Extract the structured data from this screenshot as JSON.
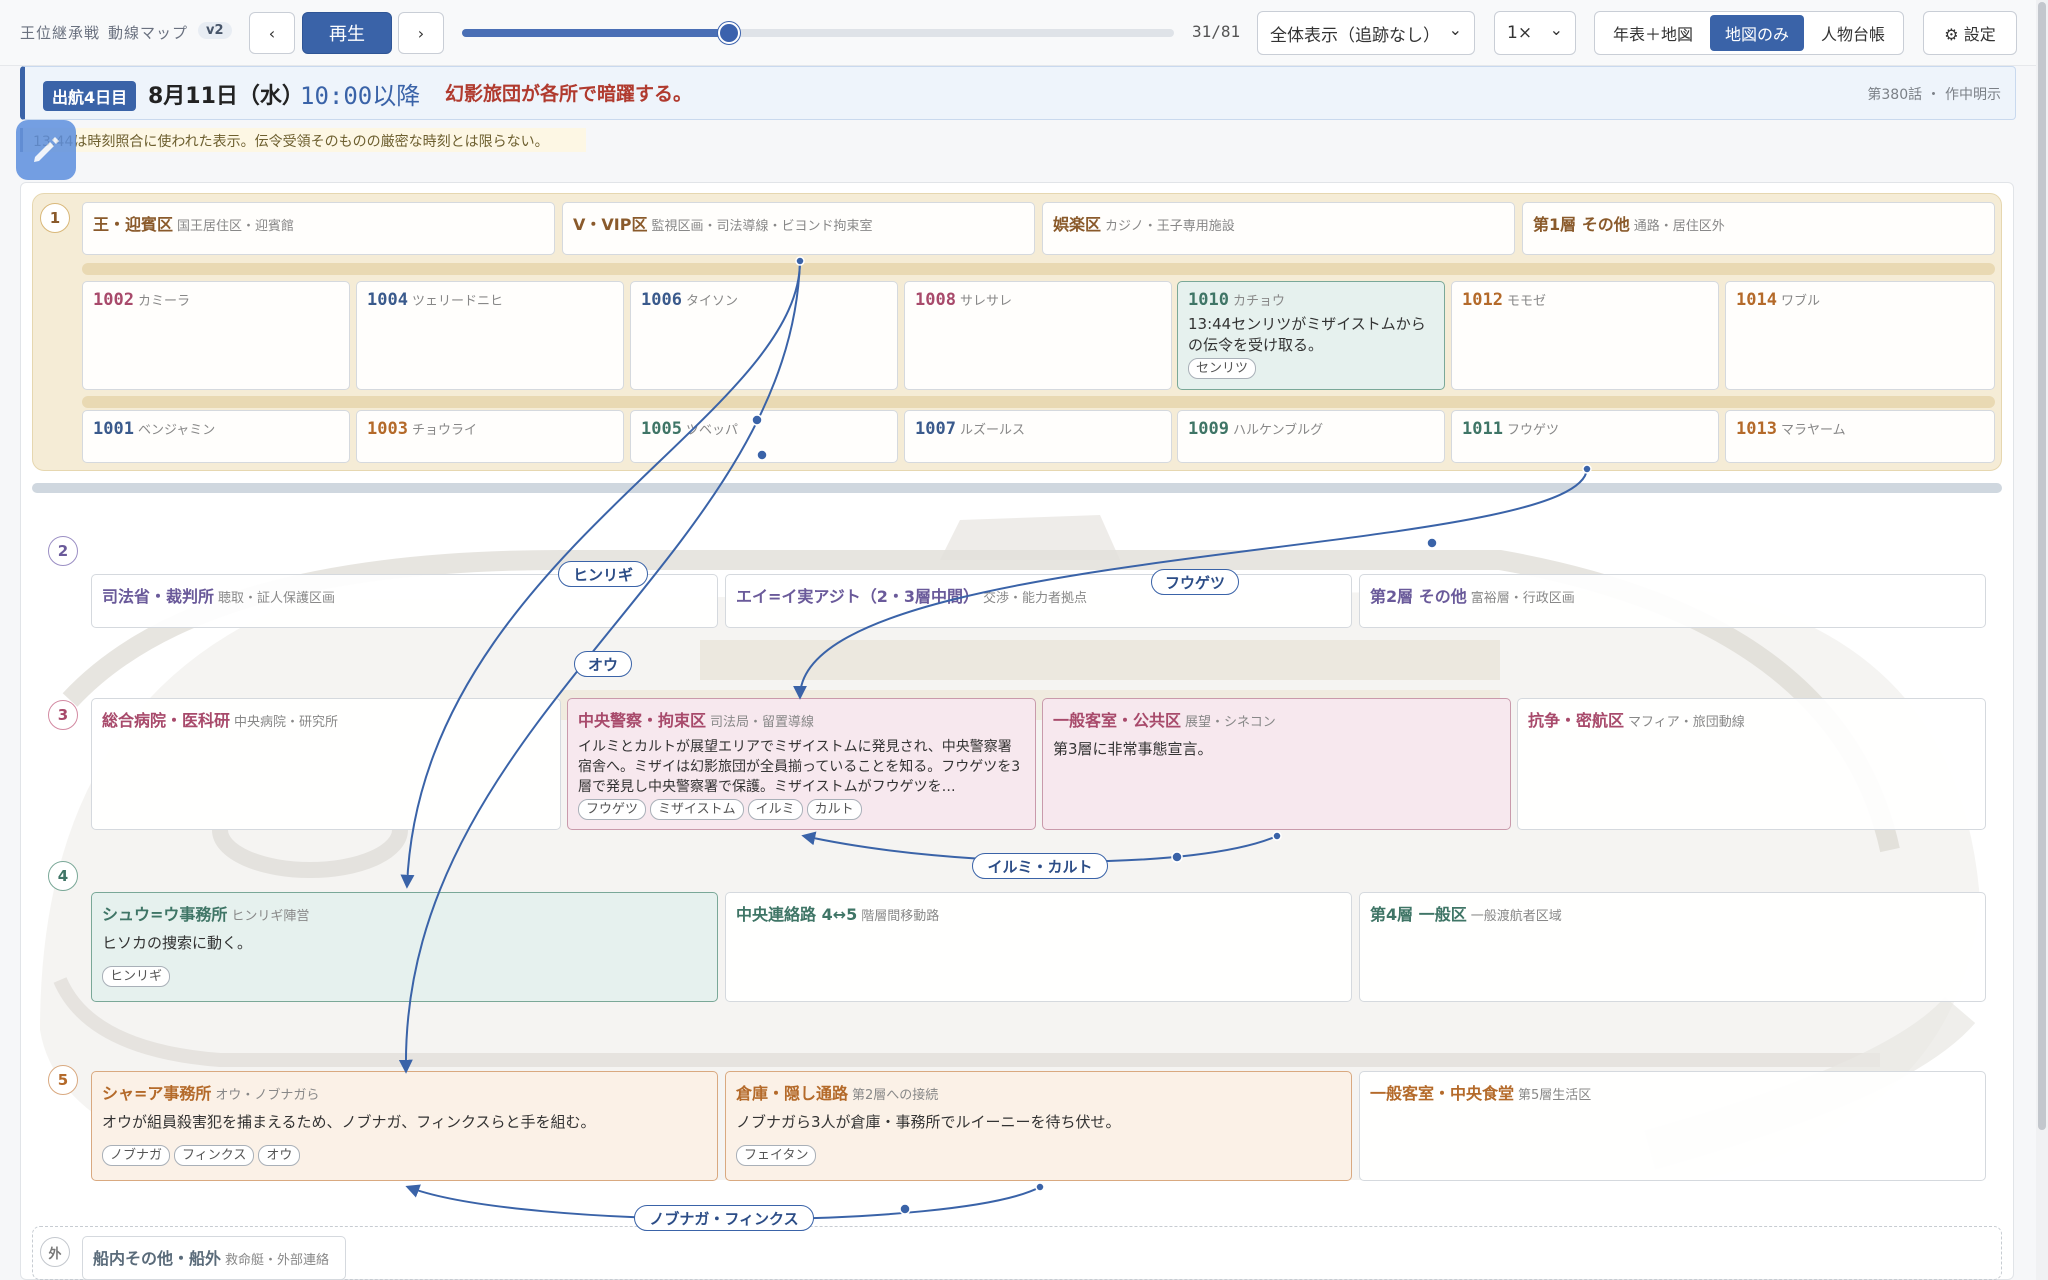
{
  "toolbar": {
    "app_title": "王位継承戦",
    "app_subtitle": "動線マップ",
    "version": "v2",
    "prev_label": "‹",
    "play_label": "再生",
    "next_label": "›",
    "counter": "31/81",
    "progress_fraction": 0.375,
    "view_select": "全体表示（追跡なし）",
    "speed_select": "1×",
    "modes": [
      "年表＋地図",
      "地図のみ",
      "人物台帳"
    ],
    "active_mode": "地図のみ",
    "settings_label": "⚙ 設定"
  },
  "banner": {
    "day": "出航4日目",
    "date": "8月11日（水）",
    "time": "10:00以降",
    "event": "幻影旅団が各所で暗躍する。",
    "episode": "第380話 ・ 作中明示"
  },
  "note": "13:44は時刻照合に使われた表示。伝令受領そのものの厳密な時刻とは限らない。",
  "floors": {
    "f1": {
      "badge": "1",
      "zones": [
        {
          "title": "王・迎賓区",
          "sub": "国王居住区・迎賓館"
        },
        {
          "title": "V・VIP区",
          "sub": "監視区画・司法導線・ビヨンド拘束室"
        },
        {
          "title": "娯楽区",
          "sub": "カジノ・王子専用施設"
        },
        {
          "title": "第1層 その他",
          "sub": "通路・居住区外"
        }
      ],
      "rooms_top": [
        {
          "num": "1002",
          "name": "カミーラ"
        },
        {
          "num": "1004",
          "name": "ツェリードニヒ"
        },
        {
          "num": "1006",
          "name": "タイソン"
        },
        {
          "num": "1008",
          "name": "サレサレ"
        },
        {
          "num": "1010",
          "name": "カチョウ",
          "text": "13:44センリツがミザイストムからの伝令を受け取る。",
          "chips": [
            "センリツ"
          ]
        },
        {
          "num": "1012",
          "name": "モモゼ"
        },
        {
          "num": "1014",
          "name": "ワブル"
        }
      ],
      "rooms_bottom": [
        {
          "num": "1001",
          "name": "ベンジャミン"
        },
        {
          "num": "1003",
          "name": "チョウライ"
        },
        {
          "num": "1005",
          "name": "ツベッパ"
        },
        {
          "num": "1007",
          "name": "ルズールス"
        },
        {
          "num": "1009",
          "name": "ハルケンブルグ"
        },
        {
          "num": "1011",
          "name": "フウゲツ"
        },
        {
          "num": "1013",
          "name": "マラヤーム"
        }
      ]
    },
    "f2": {
      "badge": "2",
      "zones": [
        {
          "title": "司法省・裁判所",
          "sub": "聴取・証人保護区画"
        },
        {
          "title": "エイ=イ実アジト（2・3層中間）",
          "sub": "交渉・能力者拠点"
        },
        {
          "title": "第2層 その他",
          "sub": "富裕層・行政区画"
        }
      ]
    },
    "f3": {
      "badge": "3",
      "zones": [
        {
          "title": "総合病院・医科研",
          "sub": "中央病院・研究所"
        },
        {
          "title": "中央警察・拘束区",
          "sub": "司法局・留置導線",
          "text": "イルミとカルトが展望エリアでミザイストムに発見され、中央警察署宿舎へ。ミザイは幻影旅団が全員揃っていることを知る。フウゲツを3層で発見し中央警察署で保護。ミザイストムがフウゲツを…",
          "chips": [
            "フウゲツ",
            "ミザイストム",
            "イルミ",
            "カルト"
          ]
        },
        {
          "title": "一般客室・公共区",
          "sub": "展望・シネコン",
          "text": "第3層に非常事態宣言。"
        },
        {
          "title": "抗争・密航区",
          "sub": "マフィア・旅団動線"
        }
      ]
    },
    "f4": {
      "badge": "4",
      "zones": [
        {
          "title": "シュウ=ウ事務所",
          "sub": "ヒンリギ陣営",
          "text": "ヒソカの捜索に動く。",
          "chips": [
            "ヒンリギ"
          ]
        },
        {
          "title": "中央連絡路 4↔5",
          "sub": "階層間移動路"
        },
        {
          "title": "第4層 一般区",
          "sub": "一般渡航者区域"
        }
      ]
    },
    "f5": {
      "badge": "5",
      "zones": [
        {
          "title": "シャ=ア事務所",
          "sub": "オウ・ノブナガら",
          "text": "オウが組員殺害犯を捕まえるため、ノブナガ、フィンクスらと手を組む。",
          "chips": [
            "ノブナガ",
            "フィンクス",
            "オウ"
          ]
        },
        {
          "title": "倉庫・隠し通路",
          "sub": "第2層への接続",
          "text": "ノブナガら3人が倉庫・事務所でルイーニーを待ち伏せ。",
          "chips": [
            "フェイタン"
          ]
        },
        {
          "title": "一般客室・中央食堂",
          "sub": "第5層生活区"
        }
      ]
    },
    "outside": {
      "badge": "外",
      "title": "船内その他・船外",
      "sub": "救命艇・外部連絡"
    }
  },
  "routes": [
    {
      "label": "ヒンリギ"
    },
    {
      "label": "オウ"
    },
    {
      "label": "フウゲツ"
    },
    {
      "label": "イルミ・カルト"
    },
    {
      "label": "ノブナガ・フィンクス"
    }
  ],
  "colors": {
    "accent": "#3a63a8",
    "route": "#3a63a8",
    "event_red": "#b03a2e"
  }
}
